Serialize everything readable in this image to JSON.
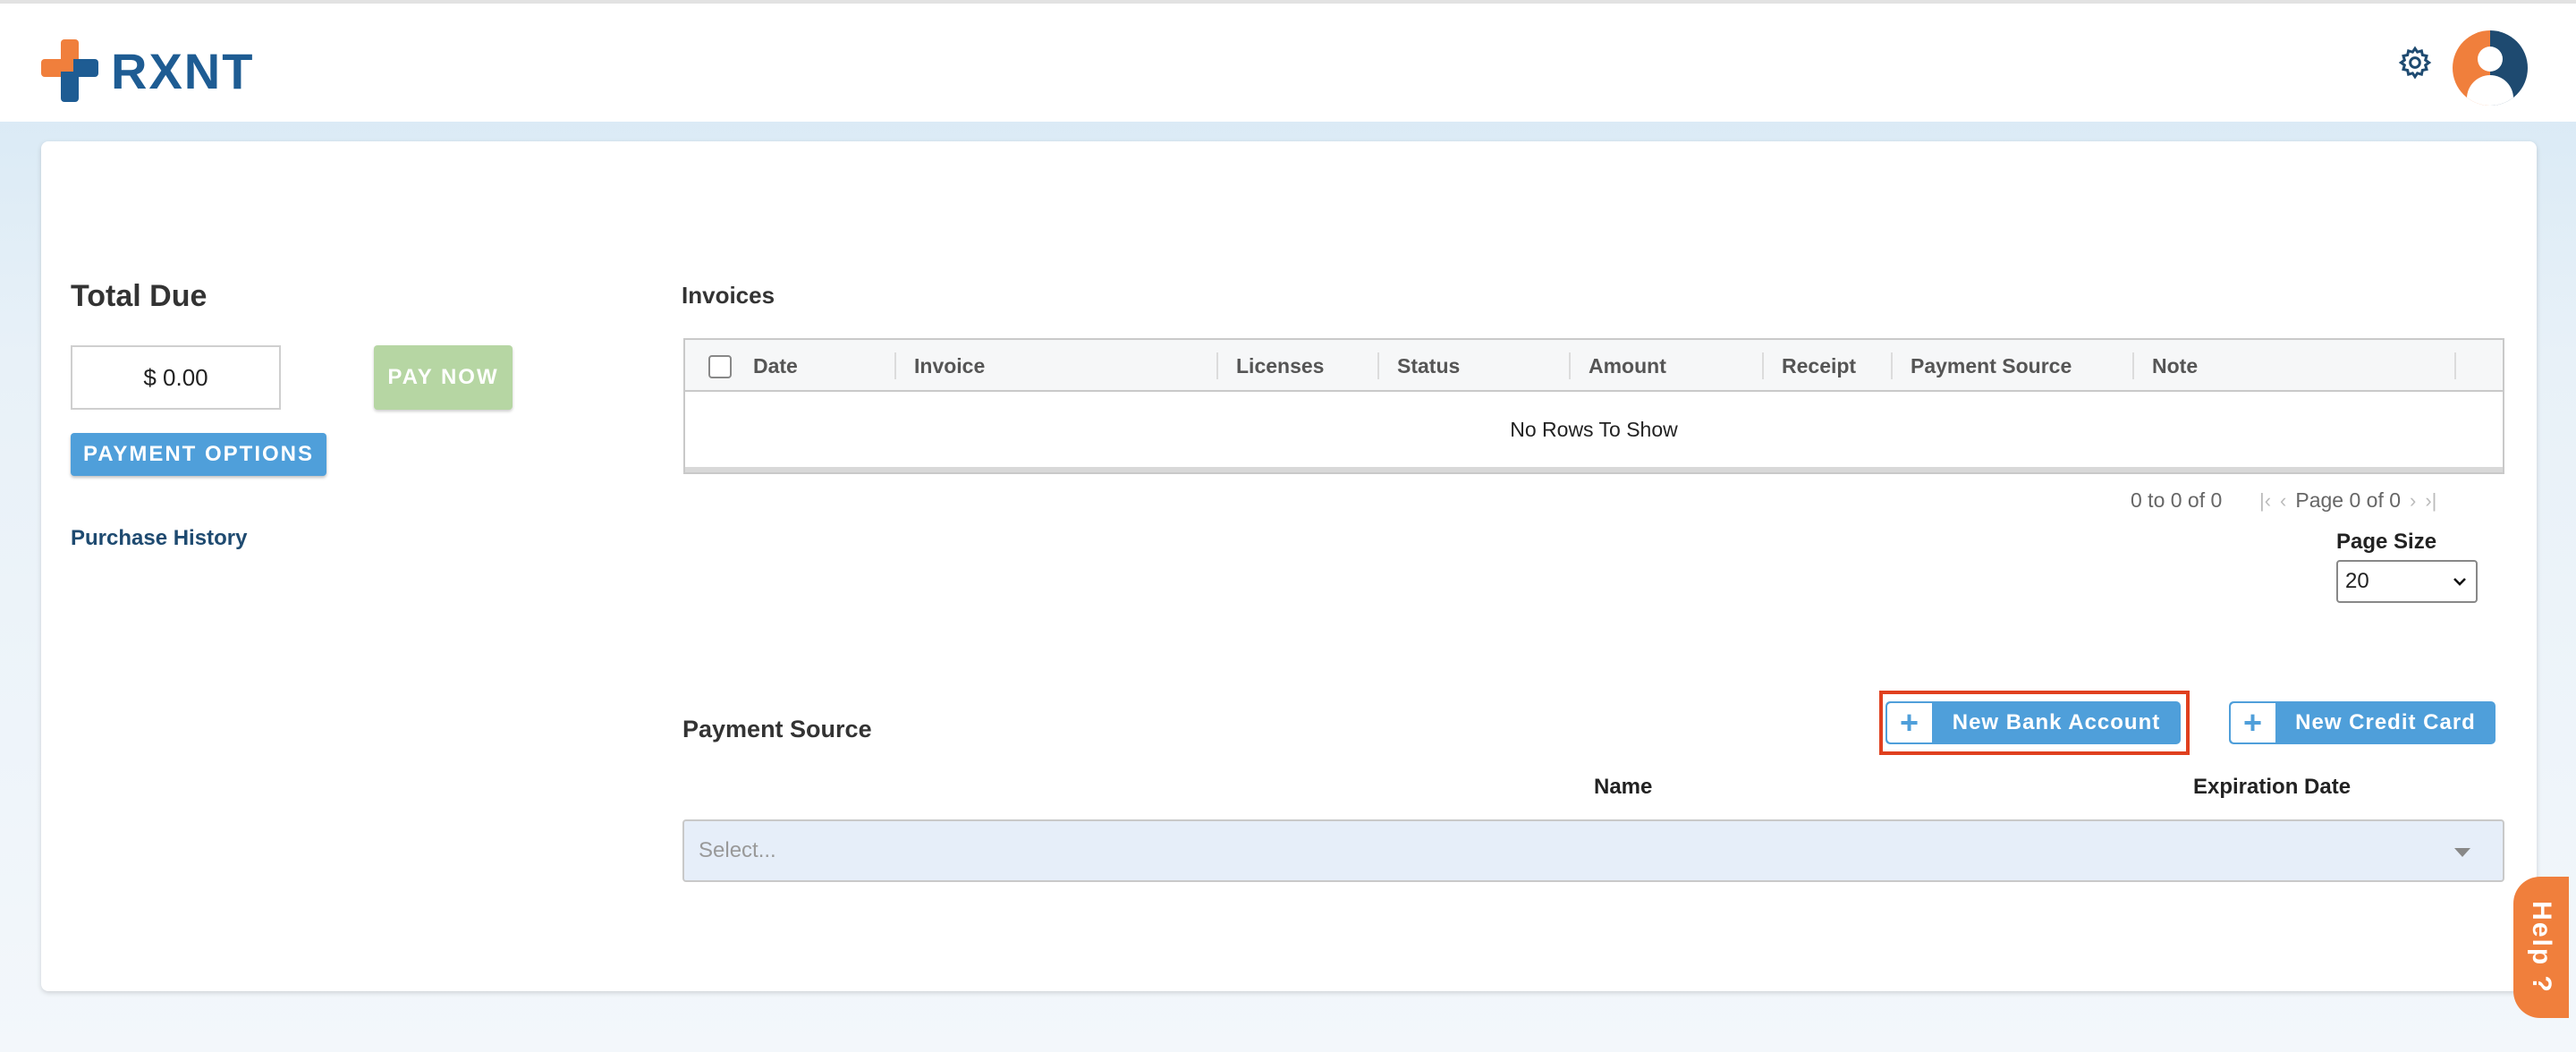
{
  "header": {
    "logo_text": "RXNT",
    "settings_icon": "gear-icon",
    "avatar_icon": "user-avatar-icon"
  },
  "summary": {
    "title": "Total Due",
    "amount": "$ 0.00",
    "pay_now_label": "PAY NOW",
    "payment_options_label": "PAYMENT OPTIONS",
    "purchase_history_label": "Purchase History"
  },
  "invoices": {
    "title": "Invoices",
    "columns": [
      "Date",
      "Invoice",
      "Licenses",
      "Status",
      "Amount",
      "Receipt",
      "Payment Source",
      "Note"
    ],
    "empty_text": "No Rows To Show",
    "pager": {
      "summary": "0 to 0 of 0",
      "page_text": "Page 0 of 0"
    },
    "page_size": {
      "label": "Page Size",
      "value": "20"
    }
  },
  "payment_source": {
    "title": "Payment Source",
    "new_bank_label": "New Bank Account",
    "new_credit_label": "New Credit Card",
    "col_name": "Name",
    "col_expiration": "Expiration Date",
    "select_placeholder": "Select..."
  },
  "help": {
    "label": "Help ?"
  },
  "colors": {
    "brand_blue": "#1e5c93",
    "brand_orange": "#f07f3c",
    "button_blue": "#4f9fda",
    "pay_now_green": "#b6d6a3",
    "highlight_red": "#e0401f"
  }
}
